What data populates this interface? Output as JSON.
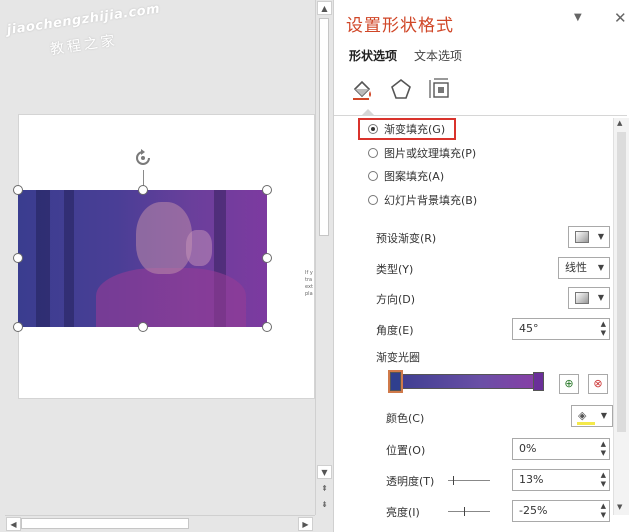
{
  "watermark": {
    "line1": "jiaochengzhijia.com",
    "line2": "教程之家"
  },
  "slide": {
    "overflow_text": [
      "If y",
      "tra",
      "ext",
      "pla"
    ]
  },
  "pane": {
    "title": "设置形状格式",
    "tabs": [
      {
        "label": "形状选项",
        "active": true
      },
      {
        "label": "文本选项",
        "active": false
      }
    ],
    "category_icons": [
      "fill-line-icon",
      "effects-icon",
      "size-properties-icon"
    ],
    "fill_options": [
      {
        "label": "渐变填充(G)",
        "checked": true
      },
      {
        "label": "图片或纹理填充(P)",
        "checked": false
      },
      {
        "label": "图案填充(A)",
        "checked": false
      },
      {
        "label": "幻灯片背景填充(B)",
        "checked": false
      }
    ],
    "preset_gradient": {
      "label": "预设渐变(R)"
    },
    "type": {
      "label": "类型(Y)",
      "value": "线性"
    },
    "direction": {
      "label": "方向(D)"
    },
    "angle": {
      "label": "角度(E)",
      "value": "45°"
    },
    "gradient_stops": {
      "label": "渐变光圈",
      "start_color": "#2f3f8e",
      "end_color": "#6a2f99"
    },
    "color": {
      "label": "颜色(C)",
      "swatch": "#f4e94a"
    },
    "position": {
      "label": "位置(O)",
      "value": "0%"
    },
    "transparency": {
      "label": "透明度(T)",
      "value": "13%",
      "level": 0.13
    },
    "brightness": {
      "label": "亮度(I)",
      "value": "-25%",
      "level": -0.25
    }
  },
  "colors": {
    "accent": "#d04627",
    "highlight": "#d9332c"
  }
}
